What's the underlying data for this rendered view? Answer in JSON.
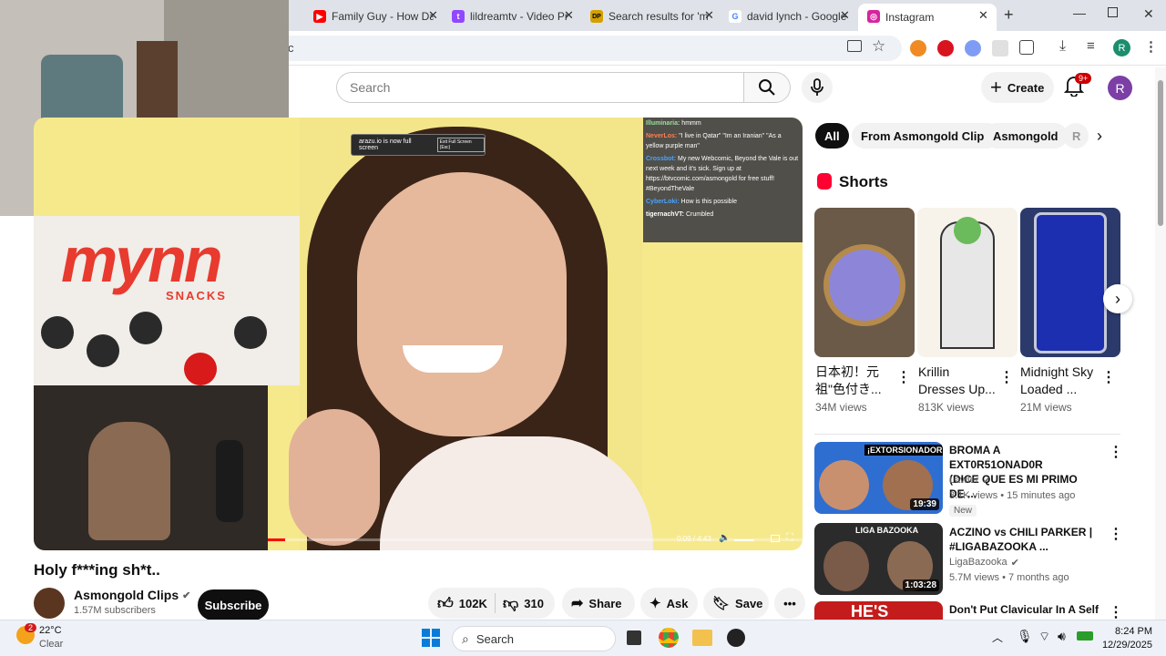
{
  "browser": {
    "tabs": [
      {
        "title": "Family Guy - How Da",
        "color": "#ff0000",
        "glyph": "▶"
      },
      {
        "title": "lildreamtv - Video Pr",
        "color": "#9146ff",
        "glyph": "t"
      },
      {
        "title": "Search results for 'm",
        "color": "#d4a000",
        "glyph": "DP"
      },
      {
        "title": "david lynch - Google",
        "color": "#4285f4",
        "glyph": "G"
      },
      {
        "title": "Instagram",
        "color": "#d6249f",
        "glyph": "◎"
      }
    ],
    "address_fragment": "c",
    "profile_initial": "R"
  },
  "youtube": {
    "search_placeholder": "Search",
    "create_label": "Create",
    "notif_badge": "9+",
    "avatar_initial": "R",
    "chips": [
      "All",
      "From Asmongold Clips",
      "Asmongold",
      "R"
    ],
    "shorts_heading": "Shorts",
    "shorts": [
      {
        "title_l1": "日本初！元",
        "title_l2": "祖\"色付き...",
        "views": "34M views"
      },
      {
        "title_l1": "Krillin",
        "title_l2": "Dresses Up...",
        "views": "813K views"
      },
      {
        "title_l1": "Midnight Sky",
        "title_l2": "Loaded ...",
        "views": "21M views"
      }
    ],
    "recommended": [
      {
        "title_l1": "BROMA A EXT0R51ONAD0R",
        "title_l2": "(DICE QUE ES MI PRIMO DE ...",
        "channel": "Lawler",
        "stats": "3.1K views • 15 minutes ago",
        "badge": "New",
        "duration": "19:39",
        "thumb_text": "¡EXTORSIONADOR!"
      },
      {
        "title_l1": "ACZINO vs CHILI PARKER |",
        "title_l2": "#LIGABAZOOKA ...",
        "channel": "LigaBazooka",
        "stats": "5.7M views • 7 months ago",
        "badge": "",
        "duration": "1:03:28",
        "thumb_text": "LIGA BAZOOKA"
      },
      {
        "title_l1": "Don't Put Clavicular In A Self",
        "title_l2": "",
        "channel": "",
        "stats": "",
        "badge": "",
        "duration": "",
        "thumb_text": "HE'S"
      }
    ],
    "video": {
      "title": "Holy f***ing sh*t..",
      "channel": "Asmongold Clips",
      "subscribers": "1.57M subscribers",
      "subscribe_label": "Subscribe",
      "likes": "102K",
      "dislikes": "310",
      "share_label": "Share",
      "ask_label": "Ask",
      "save_label": "Save",
      "time": "0:09 / 4:43",
      "progress": 0.032,
      "fullscreen_toast": "arazu.io is now full screen",
      "toast_btn": "Exit Full Screen (Esc)",
      "snack_brand": "mynn",
      "snack_sub": "SNACKS",
      "chat": [
        {
          "user": "Illuminaria",
          "msg": "hmmm"
        },
        {
          "user": "NeverLos",
          "msg": "\"I live in Qatar\" \"Im an Iranian\" \"As a yellow purple man\""
        },
        {
          "user": "Crossbot",
          "msg": "My new Webcomic, Beyond the Vale is out next week and it's sick. Sign up at https://btvcomic.com/asmongold for free stuff! #BeyondTheVale"
        },
        {
          "user": "CyberLoki",
          "msg": "How is this possible"
        },
        {
          "user": "tigernachVT",
          "msg": "Crumbled"
        }
      ]
    }
  },
  "taskbar": {
    "weather_temp": "22°C",
    "weather_desc": "Clear",
    "weather_badge": "2",
    "search_label": "Search",
    "time": "8:24 PM",
    "date": "12/29/2025"
  }
}
